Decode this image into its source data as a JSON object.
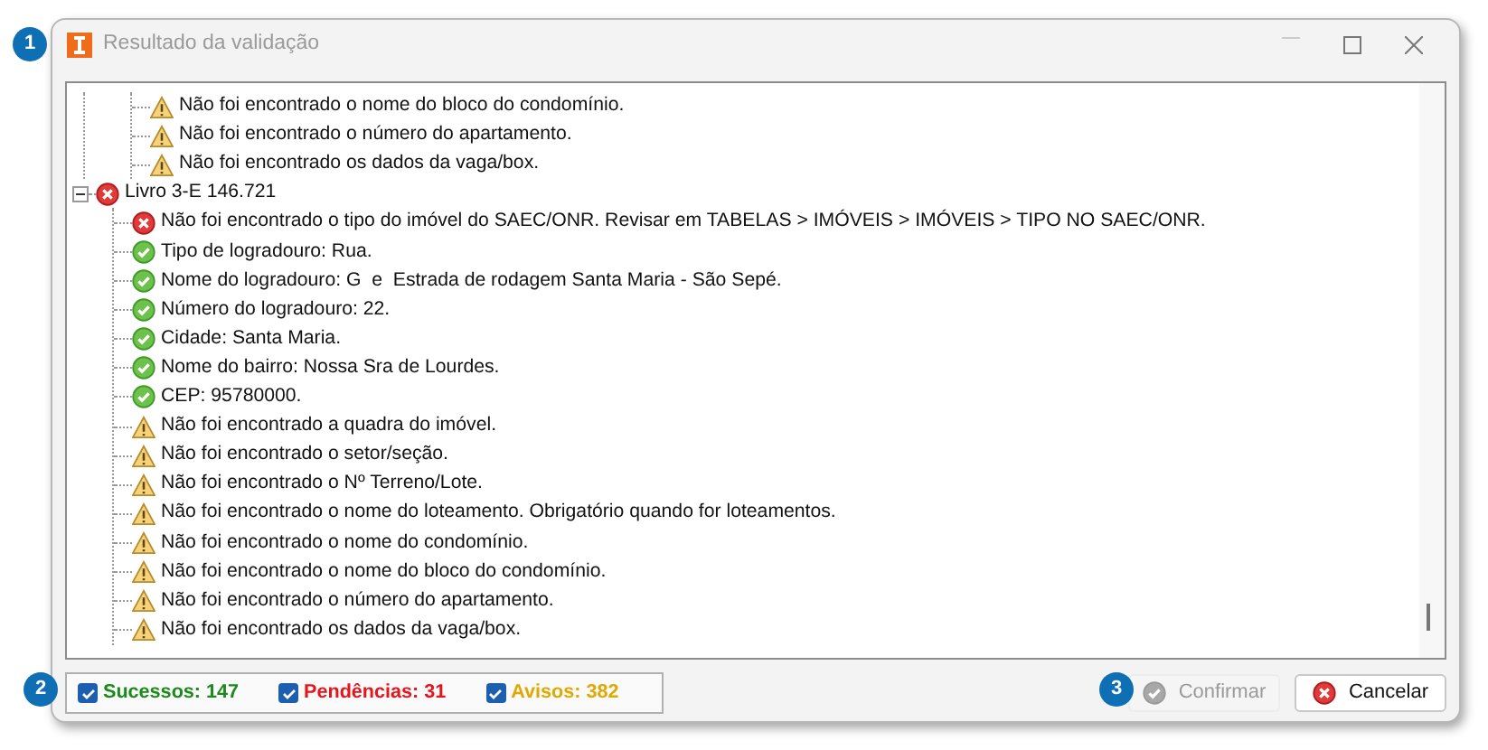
{
  "callouts": [
    "1",
    "2",
    "3"
  ],
  "window": {
    "title": "Resultado da validação"
  },
  "tree": {
    "continued_children": [
      {
        "label": "Não foi encontrado o nome do bloco do condomínio.",
        "kind": "warning"
      },
      {
        "label": "Não foi encontrado o número do apartamento.",
        "kind": "warning"
      },
      {
        "label": "Não foi encontrado os dados da vaga/box.",
        "kind": "warning"
      }
    ],
    "nodes": [
      {
        "label": "Livro 3-E 146.721",
        "kind": "error",
        "expanded": true,
        "children": [
          {
            "label": "Não foi encontrado o tipo do imóvel do SAEC/ONR. Revisar em TABELAS > IMÓVEIS > IMÓVEIS > TIPO NO SAEC/ONR.",
            "kind": "error"
          },
          {
            "label": "Tipo de logradouro: Rua.",
            "kind": "success"
          },
          {
            "label": "Nome do logradouro: G  e  Estrada de rodagem Santa Maria - São Sepé.",
            "kind": "success"
          },
          {
            "label": "Número do logradouro: 22.",
            "kind": "success"
          },
          {
            "label": "Cidade: Santa Maria.",
            "kind": "success"
          },
          {
            "label": "Nome do bairro: Nossa Sra de Lourdes.",
            "kind": "success"
          },
          {
            "label": "CEP: 95780000.",
            "kind": "success"
          },
          {
            "label": "Não foi encontrado a quadra do imóvel.",
            "kind": "warning"
          },
          {
            "label": "Não foi encontrado o setor/seção.",
            "kind": "warning"
          },
          {
            "label": "Não foi encontrado o Nº Terreno/Lote.",
            "kind": "warning"
          },
          {
            "label": "Não foi encontrado o nome do loteamento. Obrigatório quando for loteamentos.",
            "kind": "warning"
          },
          {
            "label": "Não foi encontrado o nome do condomínio.",
            "kind": "warning"
          },
          {
            "label": "Não foi encontrado o nome do bloco do condomínio.",
            "kind": "warning"
          },
          {
            "label": "Não foi encontrado o número do apartamento.",
            "kind": "warning"
          },
          {
            "label": "Não foi encontrado os dados da vaga/box.",
            "kind": "warning"
          }
        ]
      }
    ]
  },
  "filters": [
    {
      "label": "Sucessos: 147",
      "checked": true,
      "color": "#1a8a1a"
    },
    {
      "label": "Pendências: 31",
      "checked": true,
      "color": "#e8141c"
    },
    {
      "label": "Avisos: 382",
      "checked": true,
      "color": "#e0a800"
    }
  ],
  "buttons": [
    {
      "label": "Confirmar",
      "kind": "confirm",
      "disabled": true
    },
    {
      "label": "Cancelar",
      "kind": "cancel",
      "disabled": false
    }
  ]
}
